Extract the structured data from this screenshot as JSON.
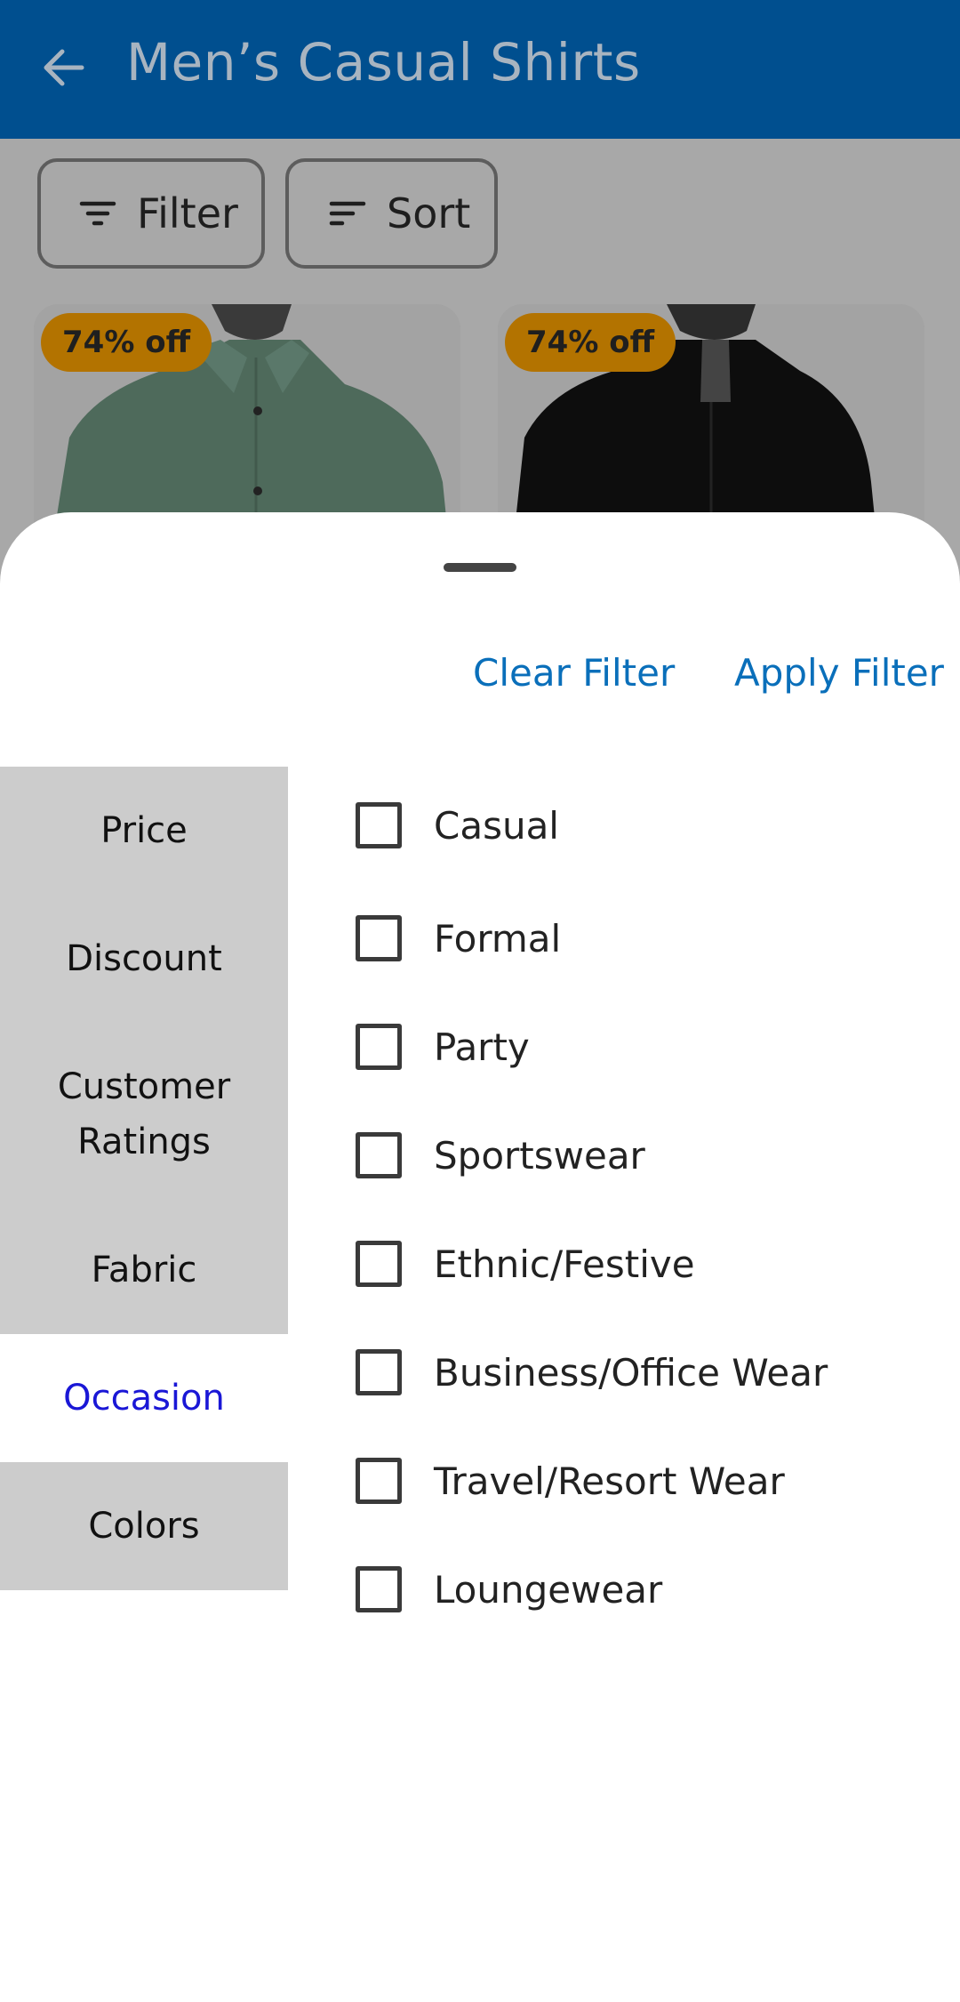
{
  "app_bar": {
    "title": "Men’s Casual Shirts",
    "back_icon": "arrow-left-icon",
    "background_color": "#004f8f"
  },
  "toolbar": {
    "filter_label": "Filter",
    "sort_label": "Sort"
  },
  "products": [
    {
      "badge": "74% off",
      "shirt_color": "#5e7a6b"
    },
    {
      "badge": "74% off",
      "shirt_color": "#111111"
    }
  ],
  "sheet": {
    "clear_label": "Clear Filter",
    "apply_label": "Apply Filter",
    "accent_color": "#0a6fba",
    "categories": [
      {
        "label": "Price",
        "active": false
      },
      {
        "label": "Discount",
        "active": false
      },
      {
        "label": "Customer Ratings",
        "active": false
      },
      {
        "label": "Fabric",
        "active": false
      },
      {
        "label": "Occasion",
        "active": true
      },
      {
        "label": "Colors",
        "active": false
      }
    ],
    "options": [
      {
        "label": "Casual",
        "checked": false
      },
      {
        "label": "Formal",
        "checked": false
      },
      {
        "label": "Party",
        "checked": false
      },
      {
        "label": "Sportswear",
        "checked": false
      },
      {
        "label": "Ethnic/Festive",
        "checked": false
      },
      {
        "label": "Business/Office Wear",
        "checked": false
      },
      {
        "label": "Travel/Resort Wear",
        "checked": false
      },
      {
        "label": "Loungewear",
        "checked": false
      }
    ]
  }
}
